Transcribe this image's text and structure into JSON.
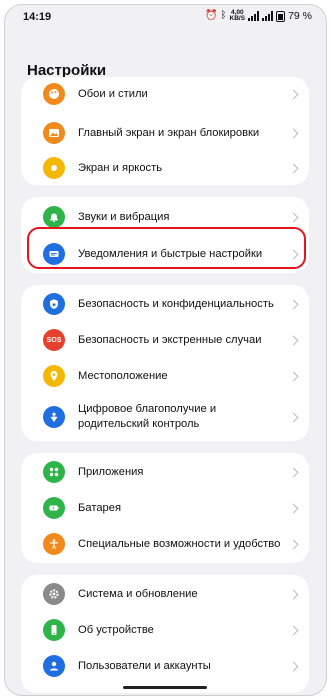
{
  "status_bar": {
    "time": "14:19",
    "net_speed": "4,00",
    "net_unit": "KB/S",
    "battery_percent": "79 %"
  },
  "header": {
    "title": "Настройки"
  },
  "groups": [
    {
      "items": [
        {
          "label": "Обои и стили",
          "icon": "palette-icon",
          "color": "#f08a1c"
        },
        {
          "label": "Главный экран и экран блокировки",
          "icon": "image-icon",
          "color": "#f08a1c"
        },
        {
          "label": "Экран и яркость",
          "icon": "sun-icon",
          "color": "#f5b800"
        }
      ]
    },
    {
      "items": [
        {
          "label": "Звуки и вибрация",
          "icon": "bell-icon",
          "color": "#2fb44a"
        },
        {
          "label": "Уведомления и быстрые настройки",
          "icon": "notification-card-icon",
          "color": "#1f6fe0",
          "highlighted": true
        }
      ]
    },
    {
      "items": [
        {
          "label": "Безопасность и конфиденциальность",
          "icon": "lock-icon",
          "color": "#1f6fe0"
        },
        {
          "label": "Безопасность и экстренные случаи",
          "icon": "sos-icon",
          "color": "#e8402e"
        },
        {
          "label": "Местоположение",
          "icon": "location-pin-icon",
          "color": "#f5b800"
        },
        {
          "label": "Цифровое благополучие и родительский контроль",
          "icon": "wellbeing-icon",
          "color": "#1f6fe0"
        }
      ]
    },
    {
      "items": [
        {
          "label": "Приложения",
          "icon": "apps-grid-icon",
          "color": "#2fb44a"
        },
        {
          "label": "Батарея",
          "icon": "battery-icon",
          "color": "#2fb44a"
        },
        {
          "label": "Специальные возможности и удобство",
          "icon": "accessibility-icon",
          "color": "#f08a1c"
        }
      ]
    },
    {
      "items": [
        {
          "label": "Система и обновление",
          "icon": "gear-icon",
          "color": "#8a8a8a"
        },
        {
          "label": "Об устройстве",
          "icon": "phone-icon",
          "color": "#2fb44a"
        },
        {
          "label": "Пользователи и аккаунты",
          "icon": "person-icon",
          "color": "#1f6fe0"
        }
      ]
    }
  ],
  "sos_text": "SOS"
}
